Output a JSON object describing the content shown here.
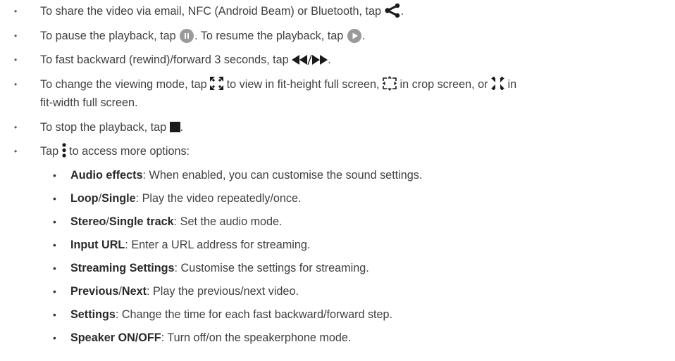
{
  "items": {
    "share": {
      "before": "To share the video via email, NFC (Android Beam) or Bluetooth, tap ",
      "icon": "share-icon",
      "after": "."
    },
    "pause": {
      "before": "To pause the playback, tap ",
      "icon1": "pause-icon",
      "mid": ". To resume the playback, tap ",
      "icon2": "play-icon",
      "after": "."
    },
    "seek": {
      "before": "To fast backward (rewind)/forward 3 seconds, tap ",
      "icon": "rewind-forward-icon",
      "after": "."
    },
    "view": {
      "before": "To change the viewing mode, tap ",
      "icon1": "fit-height-icon",
      "mid1": " to view in fit-height full screen, ",
      "icon2": "crop-screen-icon",
      "mid2": " in crop screen, or ",
      "icon3": "fit-width-icon",
      "after": " in",
      "cont": "fit-width full screen."
    },
    "stop": {
      "before": "To stop the playback, tap ",
      "icon": "stop-icon",
      "after": "."
    },
    "more": {
      "before": "Tap ",
      "icon": "more-options-icon",
      "after": " to access more options:"
    }
  },
  "options": [
    {
      "term": "Audio effects",
      "desc": ": When enabled, you can customise the sound settings."
    },
    {
      "term": "Loop",
      "sep": "/",
      "term2": "Single",
      "desc": ": Play the video repeatedly/once."
    },
    {
      "term": "Stereo",
      "sep": "/",
      "term2": "Single track",
      "desc": ": Set the audio mode."
    },
    {
      "term": "Input URL",
      "desc": ": Enter a URL address for streaming."
    },
    {
      "term": "Streaming Settings",
      "desc": ": Customise the settings for streaming."
    },
    {
      "term": "Previous",
      "sep": "/",
      "term2": "Next",
      "desc": ": Play the previous/next video."
    },
    {
      "term": "Settings",
      "desc": ": Change the time for each fast backward/forward step."
    },
    {
      "term": "Speaker ON/OFF",
      "desc": ": Turn off/on the speakerphone mode."
    }
  ],
  "bullet_char": "•",
  "colors": {
    "text": "#3f3f3f",
    "icon_dark": "#1a1a1a",
    "icon_grey": "#9a9a9a"
  }
}
